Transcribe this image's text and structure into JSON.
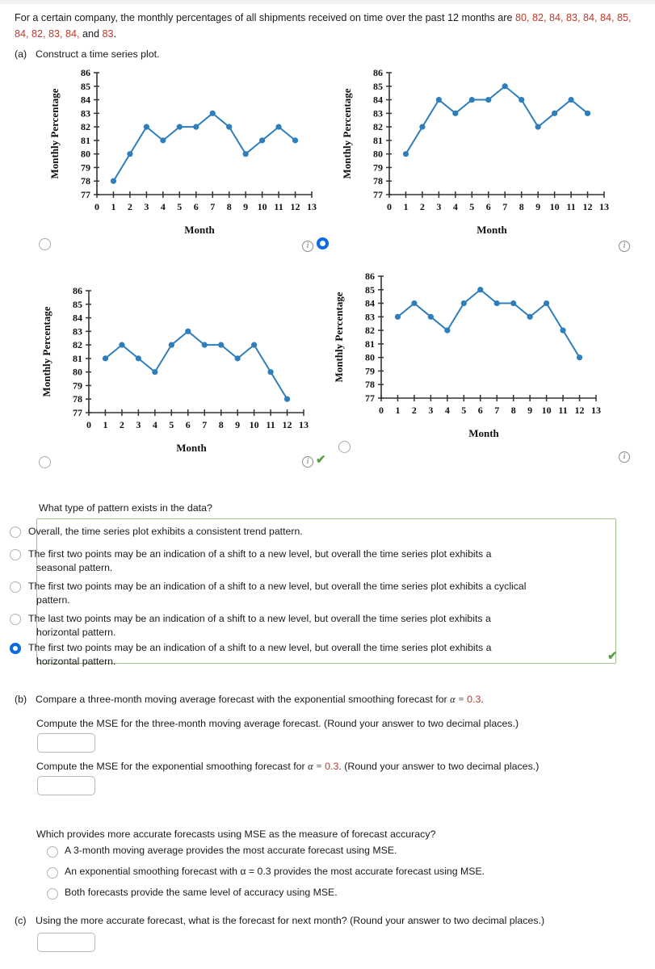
{
  "stem": {
    "lead": "For a certain company, the monthly percentages of all shipments received on time over the past 12 months are ",
    "values_text": "80, 82, 84, 83, 84, 84, 85, 84, 82, 83, 84,",
    "values_tail_and": " and ",
    "last_value": "83",
    "period": "."
  },
  "parts": {
    "a_label": "(a)",
    "a_text": "Construct a time series plot.",
    "b_label": "(b)",
    "b_text_1": "Compare a three-month moving average forecast with the exponential smoothing forecast for ",
    "b_alpha": "α = ",
    "b_alpha_value": "0.3",
    "b_text_1_end": ".",
    "c_label": "(c)",
    "c_text": "Using the more accurate forecast, what is the forecast for next month? (Round your answer to two decimal places.)"
  },
  "question": {
    "prompt": "What type of pattern exists in the data?",
    "options": [
      {
        "text": "Overall, the time series plot exhibits a consistent trend pattern.",
        "cont": "",
        "selected": false
      },
      {
        "text": "The first two points may be an indication of a shift to a new level, but overall the time series plot exhibits a",
        "cont": "seasonal pattern.",
        "selected": false
      },
      {
        "text": "The first two points may be an indication of a shift to a new level, but overall the time series plot exhibits a cyclical",
        "cont": "pattern.",
        "selected": false
      },
      {
        "text": "The last two points may be an indication of a shift to a new level, but overall the time series plot exhibits a",
        "cont": "horizontal pattern.",
        "selected": false
      },
      {
        "text": "The first two points may be an indication of a shift to a new level, but overall the time series plot exhibits a",
        "cont": "horizontal pattern.",
        "selected": true
      }
    ],
    "correct_mark": "✔"
  },
  "mse": {
    "ma_prompt": "Compute the MSE for the three-month moving average forecast. (Round your answer to two decimal places.)",
    "es_prompt_1": "Compute the MSE for the exponential smoothing forecast for ",
    "es_alpha": "α = ",
    "es_alpha_value": "0.3",
    "es_prompt_2": ". (Round your answer to two decimal places.)",
    "ma_answer": "",
    "es_answer": "",
    "next_month_answer": ""
  },
  "accuracy": {
    "prompt": "Which provides more accurate forecasts using MSE as the measure of forecast accuracy?",
    "options": [
      {
        "text": "A 3-month moving average provides the most accurate forecast using MSE.",
        "selected": false
      },
      {
        "text": "An exponential smoothing forecast with α = 0.3 provides the most accurate forecast using MSE.",
        "selected": false
      },
      {
        "text": "Both forecasts provide the same level of accuracy using MSE.",
        "selected": false
      }
    ]
  },
  "chart_common": {
    "xlabel": "Month",
    "ylabel": "Monthly Percentage",
    "yticks": [
      86,
      85,
      84,
      83,
      82,
      81,
      80,
      79,
      78,
      77
    ],
    "xticks": [
      0,
      1,
      2,
      3,
      4,
      5,
      6,
      7,
      8,
      9,
      10,
      11,
      12,
      13
    ],
    "ylim": [
      77,
      86
    ],
    "xlim": [
      0,
      13
    ],
    "series_color": "#2e7ebb",
    "grid": false,
    "legend": "none"
  },
  "chart_data": [
    {
      "id": "chart-a",
      "type": "line",
      "title": "",
      "xlabel": "Month",
      "ylabel": "Monthly Percentage",
      "x": [
        1,
        2,
        3,
        4,
        5,
        6,
        7,
        8,
        9,
        10,
        11,
        12
      ],
      "values": [
        78,
        80,
        82,
        81,
        82,
        82,
        83,
        82,
        80,
        81,
        82,
        81
      ],
      "xlim": [
        0,
        13
      ],
      "ylim": [
        77,
        86
      ],
      "selected": false
    },
    {
      "id": "chart-b",
      "type": "line",
      "title": "",
      "xlabel": "Month",
      "ylabel": "Monthly Percentage",
      "x": [
        1,
        2,
        3,
        4,
        5,
        6,
        7,
        8,
        9,
        10,
        11,
        12
      ],
      "values": [
        80,
        82,
        84,
        83,
        84,
        84,
        85,
        84,
        82,
        83,
        84,
        83
      ],
      "xlim": [
        0,
        13
      ],
      "ylim": [
        77,
        86
      ],
      "selected": true
    },
    {
      "id": "chart-c",
      "type": "line",
      "title": "",
      "xlabel": "Month",
      "ylabel": "Monthly Percentage",
      "x": [
        1,
        2,
        3,
        4,
        5,
        6,
        7,
        8,
        9,
        10,
        11,
        12
      ],
      "values": [
        81,
        82,
        81,
        80,
        82,
        83,
        82,
        82,
        81,
        82,
        80,
        78
      ],
      "xlim": [
        0,
        13
      ],
      "ylim": [
        77,
        86
      ],
      "selected": false
    },
    {
      "id": "chart-d",
      "type": "line",
      "title": "",
      "xlabel": "Month",
      "ylabel": "Monthly Percentage",
      "x": [
        1,
        2,
        3,
        4,
        5,
        6,
        7,
        8,
        9,
        10,
        11,
        12
      ],
      "values": [
        83,
        84,
        83,
        82,
        84,
        85,
        84,
        84,
        83,
        84,
        82,
        80
      ],
      "xlim": [
        0,
        13
      ],
      "ylim": [
        77,
        86
      ],
      "selected": false
    }
  ],
  "icons": {
    "info": "i",
    "check": "✔"
  }
}
